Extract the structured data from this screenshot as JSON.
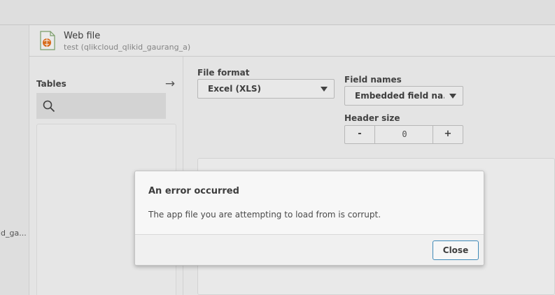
{
  "app": {
    "left_rail_label": "id_ga..."
  },
  "header": {
    "icon": "web-file-icon",
    "title": "Web file",
    "subtitle": "test (qlikcloud_qlikid_gaurang_a)"
  },
  "tables": {
    "label": "Tables",
    "arrow_icon": "arrow-right-icon",
    "search_icon": "search-icon",
    "search_placeholder": ""
  },
  "options": {
    "file_format_label": "File format",
    "file_format_value": "Excel (XLS)",
    "field_names_label": "Field names",
    "field_names_value": "Embedded field na...",
    "header_size_label": "Header size",
    "header_size_minus": "-",
    "header_size_value": "0",
    "header_size_plus": "+"
  },
  "dialog": {
    "title": "An error occurred",
    "message": "The app file you are attempting to load from is corrupt.",
    "close_label": "Close"
  },
  "colors": {
    "accent_border": "#3f8ab8",
    "file_icon_orange": "#e0701c",
    "file_icon_green": "#4a8c3a"
  }
}
